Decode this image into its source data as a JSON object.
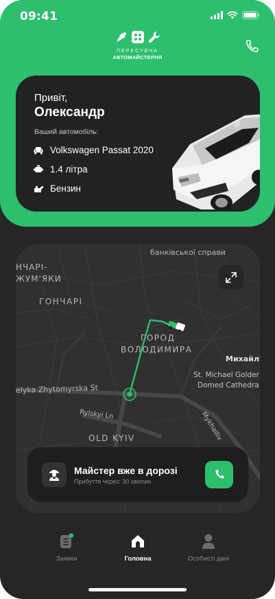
{
  "status_bar": {
    "time": "09:41"
  },
  "brand": {
    "line1": "ПЕРЕСУВНА",
    "line2": "АВТОМАЙСТЕРНЯ"
  },
  "greeting": {
    "hello": "Привіт,",
    "name": "Олександр"
  },
  "car": {
    "label": "Ваший автомобіль:",
    "model": "Volkswagen Passat 2020",
    "engine": "1.4 літра",
    "fuel": "Бензин"
  },
  "map": {
    "labels": {
      "bank": "банківської справи",
      "goncharikum_1": "НЧАРІ-",
      "goncharikum_2": "ЖУМ'ЯКИ",
      "goncahri": "ГОНЧАРІ",
      "gorod_1": "ГОРОД",
      "gorod_2": "ВОЛОДИМИРА",
      "mykhail": "Михайлі",
      "stmichael_1": "St. Michael Golder",
      "stmichael_2": "Domed Cathedra",
      "zhytomyrska": "elyka Zhytomyrska St",
      "rylskyi": "Rylskyi Ln",
      "mykhailivska": "Mykhailiv",
      "oldkyiv": "OLD KYIV"
    }
  },
  "status_card": {
    "title": "Майстер вже в дорозі",
    "subtitle": "Прибуття через: 30 хвилин"
  },
  "nav": {
    "items": [
      {
        "label": "Заявки"
      },
      {
        "label": "Головна"
      },
      {
        "label": "Особисті дані"
      }
    ]
  },
  "colors": {
    "accent": "#2dbf6e",
    "background": "#262626",
    "card": "#222222"
  },
  "icons": {
    "status": [
      "signal-icon",
      "wifi-icon",
      "battery-icon"
    ],
    "brand": [
      "spark-plug-icon",
      "engine-icon",
      "wrench-icon"
    ],
    "specs": [
      "car-icon",
      "engine-icon",
      "fuel-icon"
    ]
  }
}
